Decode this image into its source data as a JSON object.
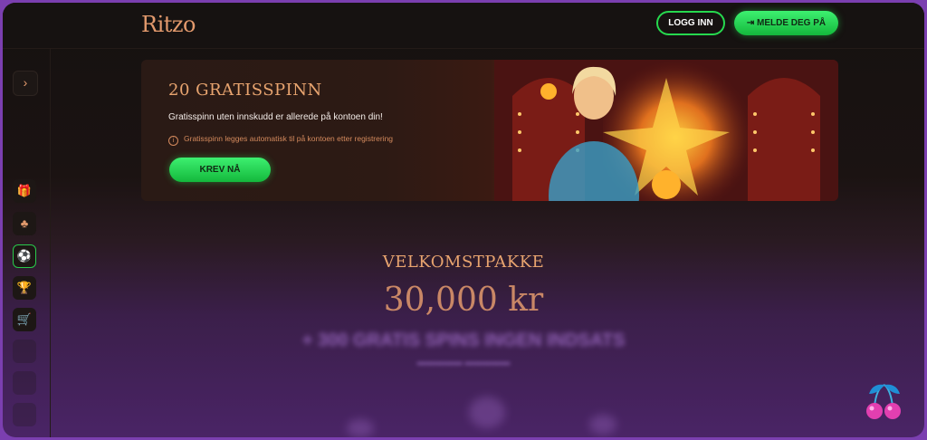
{
  "header": {
    "logo": "Ritzo",
    "login_label": "LOGG INN",
    "signup_label": "MELDE DEG PÅ",
    "signup_icon": "login-arrow-icon"
  },
  "sidebar": {
    "toggle_icon": "chevron-right-icon",
    "toggle_glyph": "›",
    "items": [
      {
        "icon": "gift-icon",
        "glyph": "🎁"
      },
      {
        "icon": "club-icon",
        "glyph": "♣"
      },
      {
        "icon": "sports-ball-icon",
        "glyph": "⚽",
        "active": true
      },
      {
        "icon": "trophy-icon",
        "glyph": "🏆"
      },
      {
        "icon": "cart-icon",
        "glyph": "🛒"
      }
    ]
  },
  "promo": {
    "title": "20 GRATISSPINN",
    "subtitle": "Gratisspinn uten innskudd er allerede på kontoen din!",
    "info_icon": "i",
    "info_text": "Gratisspinn legges automatisk til på kontoen etter registrering",
    "cta_label": "KREV NÅ"
  },
  "welcome": {
    "title": "VELKOMSTPAKKE",
    "amount": "30,000 kr",
    "spins": "+ 300 GRATIS SPINS INGEN INDSATS"
  },
  "colors": {
    "accent": "#e39a6d",
    "cta_green": "#26d94e",
    "background": "#151110",
    "purple": "#4a2466"
  }
}
